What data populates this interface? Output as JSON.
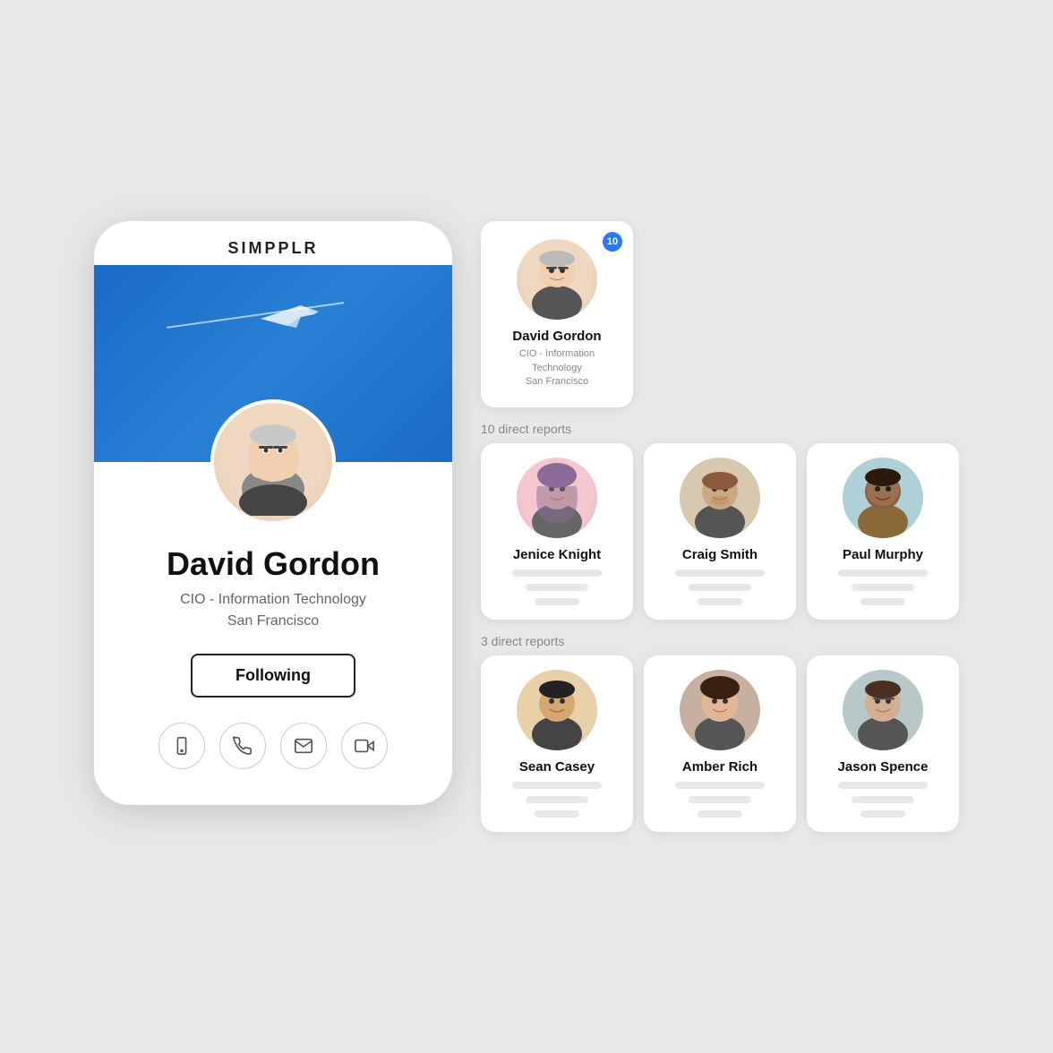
{
  "app": {
    "logo": "SIMPPLR"
  },
  "profile": {
    "name": "David Gordon",
    "title": "CIO - Information Technology",
    "location": "San Francisco",
    "following_label": "Following",
    "notification_count": "10"
  },
  "actions": [
    {
      "name": "mobile-icon",
      "label": "Mobile"
    },
    {
      "name": "phone-icon",
      "label": "Phone"
    },
    {
      "name": "email-icon",
      "label": "Email"
    },
    {
      "name": "video-icon",
      "label": "Video"
    }
  ],
  "direct_reports_label": "10 direct reports",
  "direct_reports_label_2": "3 direct reports",
  "reports": [
    {
      "name": "Jenice Knight",
      "id": "jenice"
    },
    {
      "name": "Craig Smith",
      "id": "craig"
    },
    {
      "name": "Paul Murphy",
      "id": "paul"
    }
  ],
  "reports2": [
    {
      "name": "Sean Casey",
      "id": "sean"
    },
    {
      "name": "Amber Rich",
      "id": "amber"
    },
    {
      "name": "Jason Spence",
      "id": "jason"
    }
  ]
}
